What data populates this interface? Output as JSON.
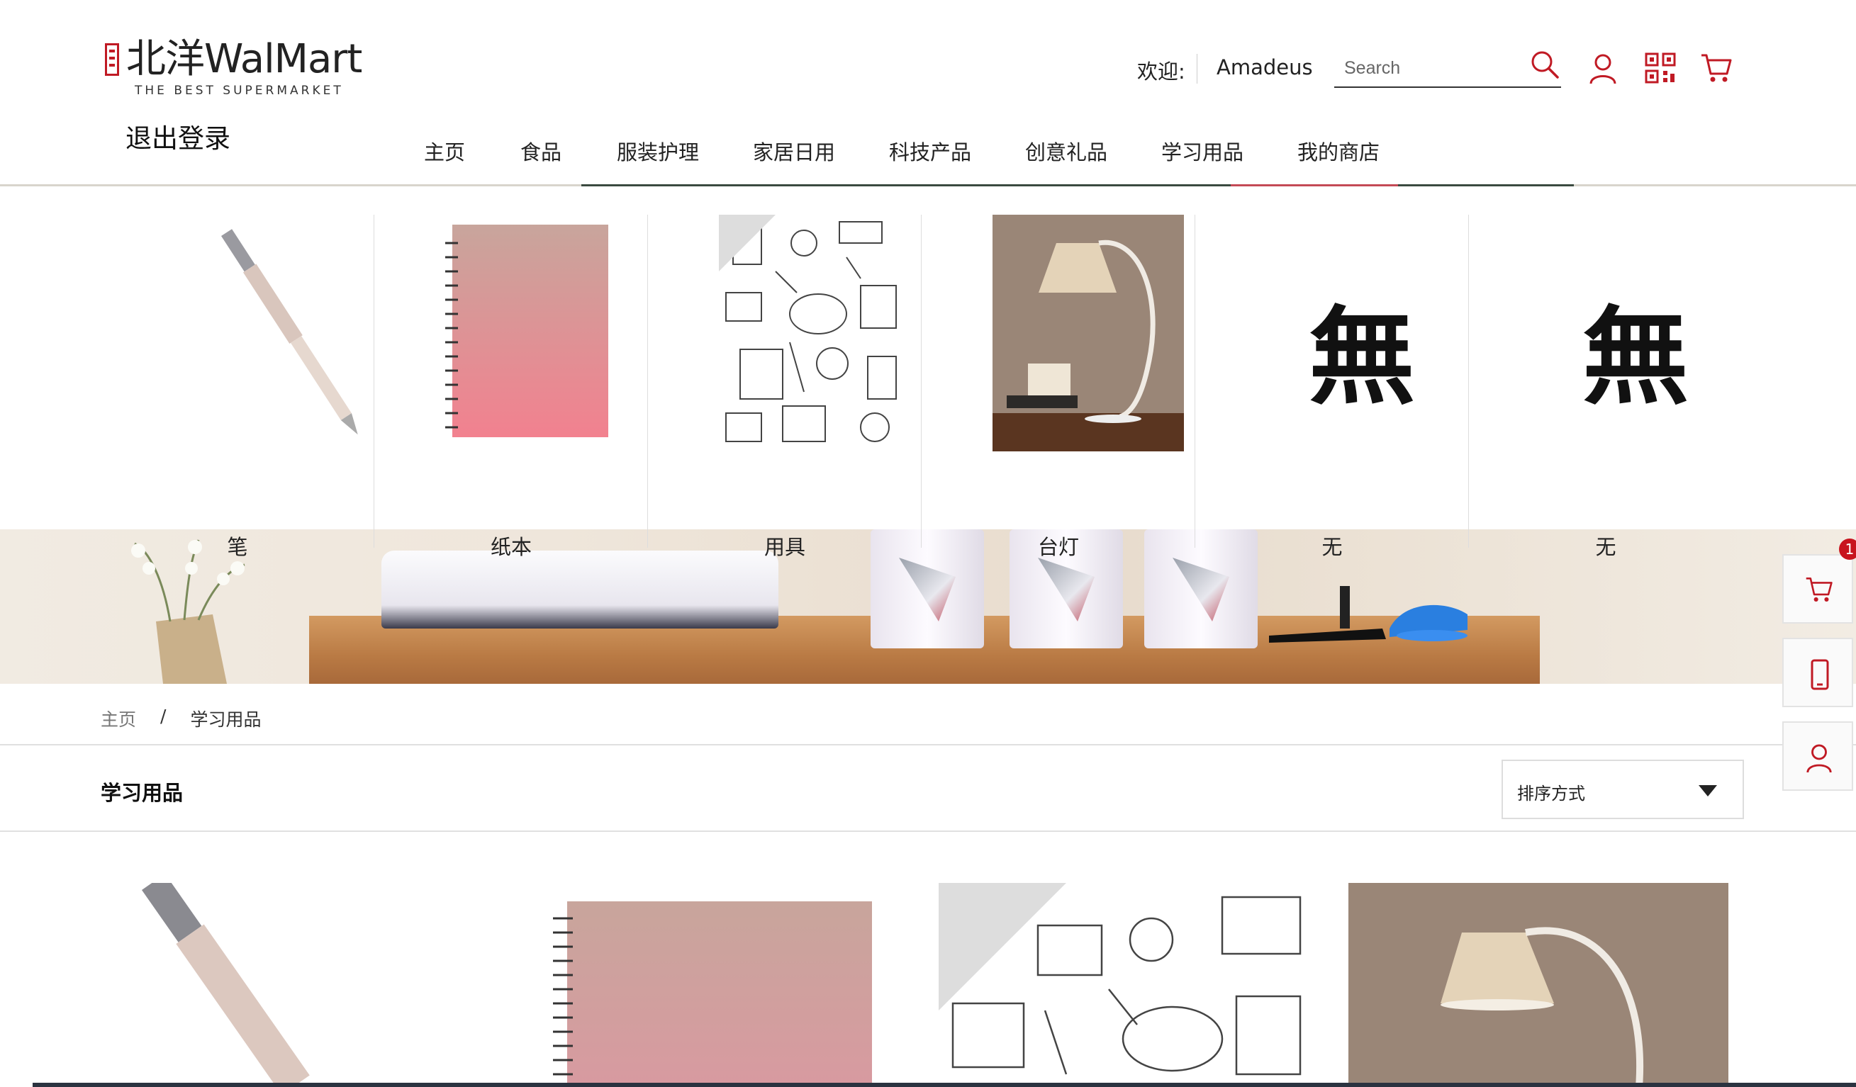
{
  "header": {
    "logo": {
      "cn": "北洋",
      "en": "WalMart",
      "tagline": "THE BEST SUPERMARKET"
    },
    "logout_label": "退出登录",
    "welcome_label": "欢迎:",
    "username": "Amadeus",
    "search": {
      "placeholder": "Search",
      "value": ""
    },
    "icons": [
      "search-icon",
      "user-icon",
      "qr-code-icon",
      "cart-icon"
    ],
    "accent_color": "#c01a24"
  },
  "nav": {
    "items": [
      {
        "label": "主页"
      },
      {
        "label": "食品"
      },
      {
        "label": "服装护理"
      },
      {
        "label": "家居日用"
      },
      {
        "label": "科技产品"
      },
      {
        "label": "创意礼品"
      },
      {
        "label": "学习用品"
      },
      {
        "label": "我的商店"
      }
    ]
  },
  "dropdown": {
    "categories": [
      {
        "label": "笔",
        "image": "pen"
      },
      {
        "label": "纸本",
        "image": "notebook"
      },
      {
        "label": "用具",
        "image": "stationery-pattern"
      },
      {
        "label": "台灯",
        "image": "desk-lamp"
      },
      {
        "label": "无",
        "image": "mu-character",
        "glyph": "無"
      },
      {
        "label": "无",
        "image": "mu-character",
        "glyph": "無"
      }
    ]
  },
  "breadcrumb": {
    "home": "主页",
    "separator": "/",
    "current": "学习用品"
  },
  "section": {
    "title": "学习用品",
    "sort_label": "排序方式"
  },
  "products": [
    {
      "image": "pen"
    },
    {
      "image": "notebook"
    },
    {
      "image": "stationery-pattern"
    },
    {
      "image": "desk-lamp"
    }
  ],
  "sidebar": {
    "cart_badge": "1",
    "buttons": [
      "cart-icon",
      "mobile-icon",
      "user-icon"
    ]
  }
}
